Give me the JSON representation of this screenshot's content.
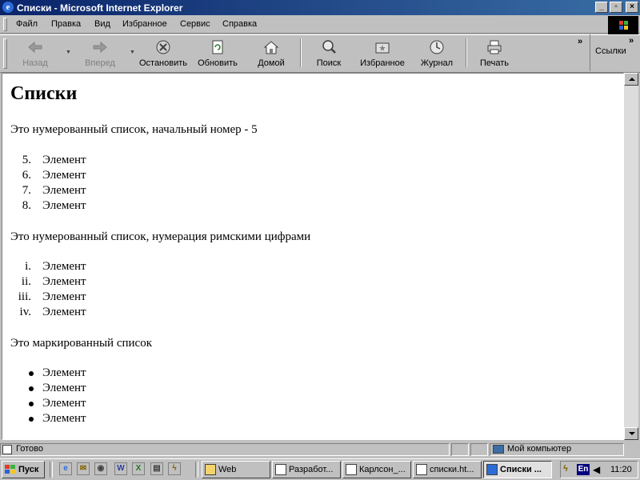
{
  "window": {
    "title": "Списки - Microsoft Internet Explorer",
    "controls": {
      "minimize": "_",
      "maximize": "▫",
      "close": "×"
    }
  },
  "menu": {
    "items": [
      "Файл",
      "Правка",
      "Вид",
      "Избранное",
      "Сервис",
      "Справка"
    ]
  },
  "toolbar": {
    "buttons": [
      {
        "label": "Назад",
        "icon": "back-arrow-icon",
        "enabled": false
      },
      {
        "label": "Вперед",
        "icon": "forward-arrow-icon",
        "enabled": false
      },
      {
        "label": "Остановить",
        "icon": "stop-icon",
        "enabled": true
      },
      {
        "label": "Обновить",
        "icon": "refresh-icon",
        "enabled": true
      },
      {
        "label": "Домой",
        "icon": "home-icon",
        "enabled": true
      },
      {
        "label": "Поиск",
        "icon": "search-icon",
        "enabled": true
      },
      {
        "label": "Избранное",
        "icon": "favorites-icon",
        "enabled": true
      },
      {
        "label": "Журнал",
        "icon": "history-icon",
        "enabled": true
      },
      {
        "label": "Печать",
        "icon": "print-icon",
        "enabled": true
      }
    ],
    "links_label": "Ссылки",
    "chevron": "»"
  },
  "page": {
    "heading": "Списки",
    "sections": [
      {
        "intro": "Это нумерованный список, начальный номер - 5",
        "type": "ordered",
        "markers": [
          "5.",
          "6.",
          "7.",
          "8."
        ],
        "items": [
          "Элемент",
          "Элемент",
          "Элемент",
          "Элемент"
        ]
      },
      {
        "intro": "Это нумерованный список, нумерация римскими цифрами",
        "type": "ordered",
        "markers": [
          "i.",
          "ii.",
          "iii.",
          "iv."
        ],
        "items": [
          "Элемент",
          "Элемент",
          "Элемент",
          "Элемент"
        ]
      },
      {
        "intro": "Это маркированный список",
        "type": "bulleted",
        "items": [
          "Элемент",
          "Элемент",
          "Элемент",
          "Элемент"
        ]
      }
    ]
  },
  "status": {
    "text": "Готово",
    "zone": "Мой компьютер"
  },
  "taskbar": {
    "start_label": "Пуск",
    "tasks": [
      {
        "label": "Web",
        "active": false
      },
      {
        "label": "Разработ...",
        "active": false
      },
      {
        "label": "Карлсон_...",
        "active": false
      },
      {
        "label": "списки.ht...",
        "active": false
      },
      {
        "label": "Списки ...",
        "active": true
      }
    ],
    "language": "En",
    "clock": "11:20"
  },
  "colors": {
    "titlebar_start": "#0a246a",
    "titlebar_end": "#3a6ea5",
    "chrome": "#c0c0c0"
  }
}
